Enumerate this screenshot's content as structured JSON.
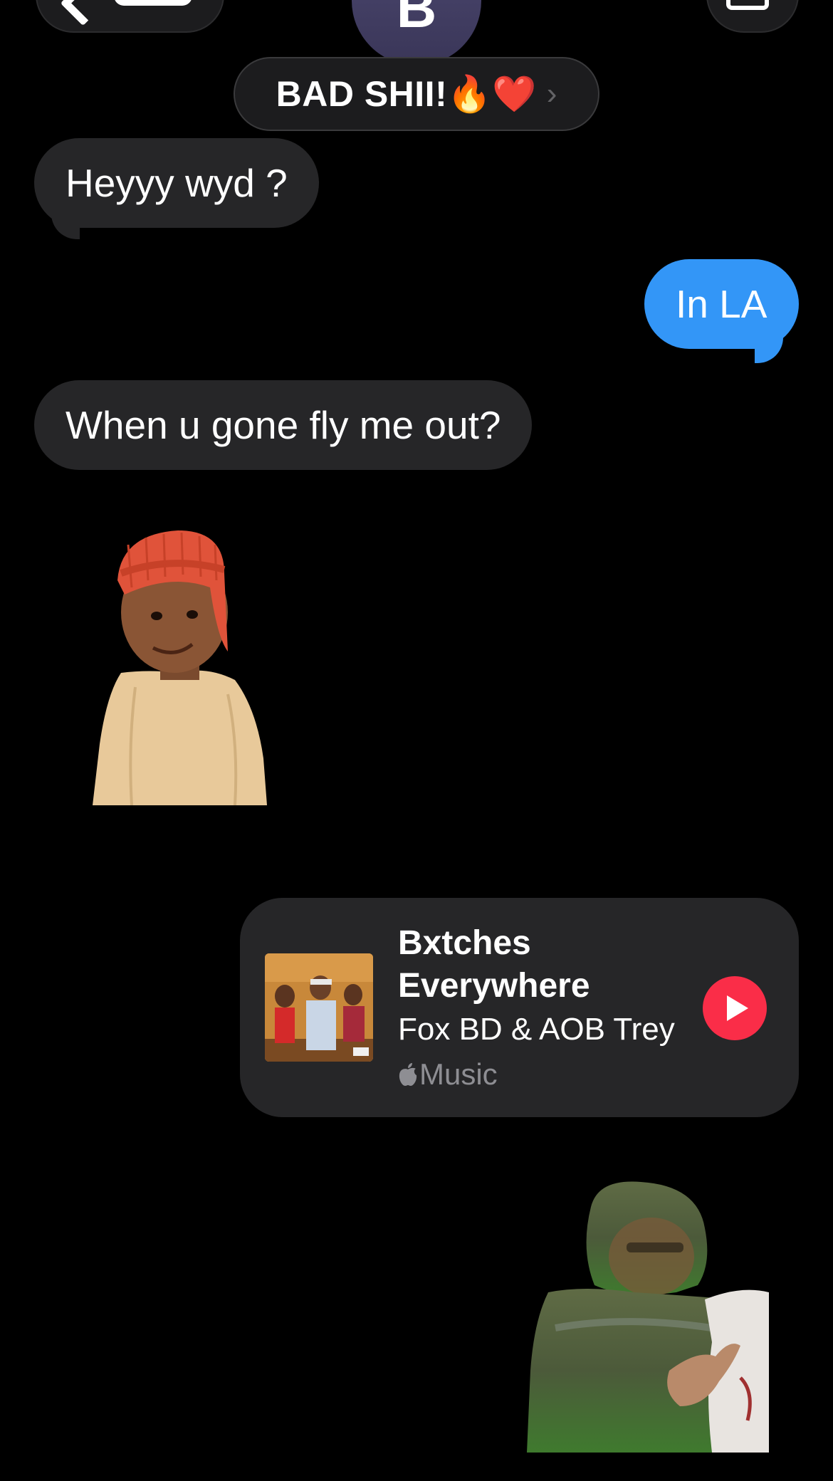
{
  "header": {
    "avatar_initial": "B",
    "contact_name": "BAD SHII!🔥❤️",
    "chevron": "›",
    "icons": [
      "back-chevron-icon",
      "video-camera-icon"
    ]
  },
  "messages": [
    {
      "direction": "incoming",
      "text": "Heyyy wyd ?"
    },
    {
      "direction": "outgoing",
      "text": "In LA"
    },
    {
      "direction": "incoming",
      "text": "When u gone fly me out?"
    }
  ],
  "music": {
    "title": "Bxtches Everywhere",
    "artist": "Fox BD & AOB Trey",
    "service": "Music",
    "service_icon": "apple-logo-icon",
    "play_icon": "play-icon",
    "accent": "#fa2d48"
  },
  "colors": {
    "incoming_bubble": "#262628",
    "outgoing_bubble": "#3396f7",
    "background": "#000000"
  }
}
